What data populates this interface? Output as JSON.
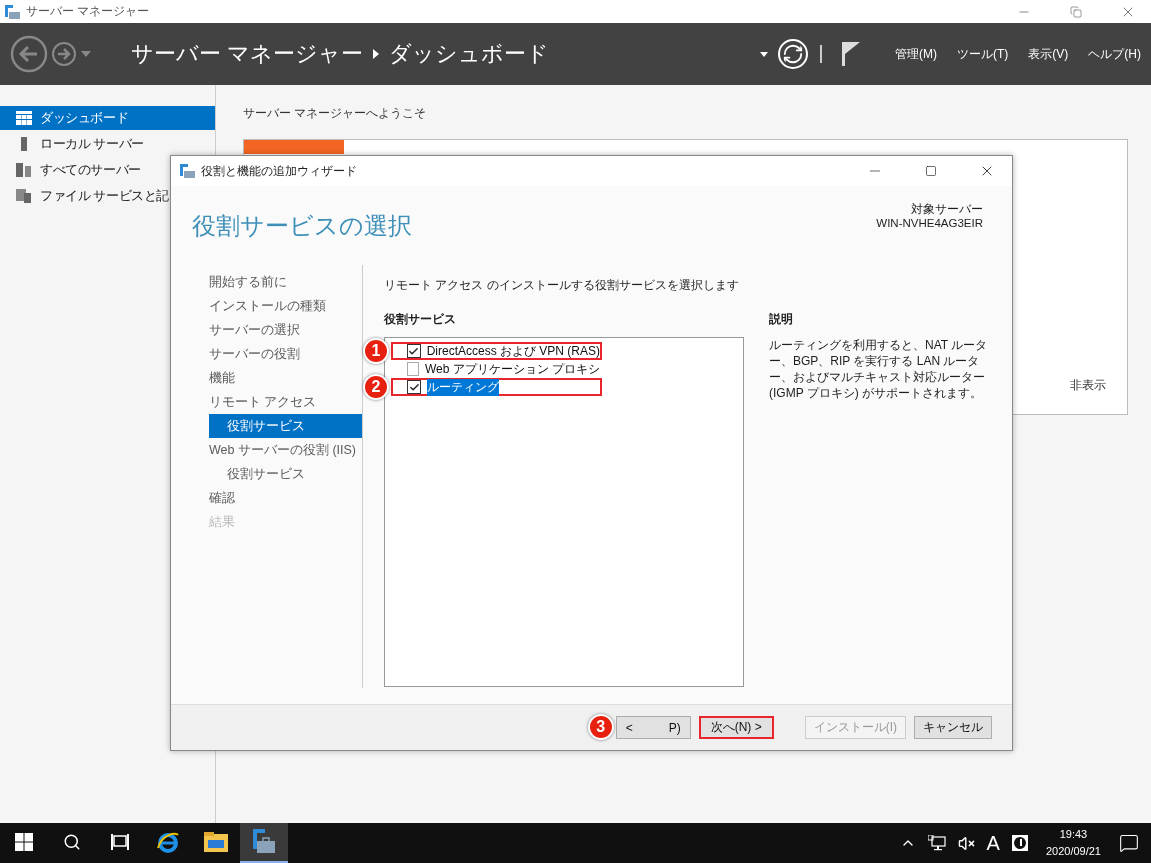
{
  "app": {
    "title": "サーバー マネージャー"
  },
  "header": {
    "breadcrumb": [
      "サーバー マネージャー",
      "ダッシュボード"
    ],
    "menus": [
      "管理(M)",
      "ツール(T)",
      "表示(V)",
      "ヘルプ(H)"
    ]
  },
  "sidebar": {
    "items": [
      {
        "kind": "dashboard",
        "label": "ダッシュボード",
        "selected": true
      },
      {
        "kind": "local",
        "label": "ローカル サーバー",
        "selected": false
      },
      {
        "kind": "all",
        "label": "すべてのサーバー",
        "selected": false
      },
      {
        "kind": "files",
        "label": "ファイル サービスと記",
        "selected": false
      }
    ]
  },
  "welcome": {
    "title": "サーバー マネージャーへようこそ",
    "hide_link": "非表示"
  },
  "wizard": {
    "title": "役割と機能の追加ウィザード",
    "page_title": "役割サービスの選択",
    "target_label": "対象サーバー",
    "target_server": "WIN-NVHE4AG3EIR",
    "steps": [
      {
        "label": "開始する前に",
        "selected": false,
        "disabled": false
      },
      {
        "label": "インストールの種類",
        "selected": false,
        "disabled": false
      },
      {
        "label": "サーバーの選択",
        "selected": false,
        "disabled": false
      },
      {
        "label": "サーバーの役割",
        "selected": false,
        "disabled": false
      },
      {
        "label": "機能",
        "selected": false,
        "disabled": false
      },
      {
        "label": "リモート アクセス",
        "selected": false,
        "disabled": false,
        "children": [
          {
            "label": "役割サービス",
            "selected": true,
            "disabled": false
          }
        ]
      },
      {
        "label": "Web サーバーの役割 (IIS)",
        "selected": false,
        "disabled": false,
        "children": [
          {
            "label": "役割サービス",
            "selected": false,
            "disabled": false
          }
        ]
      },
      {
        "label": "確認",
        "selected": false,
        "disabled": false
      },
      {
        "label": "結果",
        "selected": false,
        "disabled": true
      }
    ],
    "instruction": "リモート アクセス のインストールする役割サービスを選択します",
    "services_heading": "役割サービス",
    "services": [
      {
        "label": "DirectAccess および VPN (RAS)",
        "checked": true,
        "selected": false,
        "callout": "1"
      },
      {
        "label": "Web アプリケーション プロキシ",
        "checked": false,
        "selected": false
      },
      {
        "label": "ルーティング",
        "checked": true,
        "selected": true,
        "callout": "2"
      }
    ],
    "description": {
      "heading": "説明",
      "text": "ルーティングを利用すると、NAT ルーター、BGP、RIP を実行する LAN ルーター、およびマルチキャスト対応ルーター (IGMP プロキシ) がサポートされます。"
    },
    "buttons": [
      {
        "kind": "back",
        "label_start": "<",
        "label_end": "P)",
        "disabled": false,
        "callout": "3",
        "highlighted": false
      },
      {
        "kind": "next",
        "label": "次へ(N) >",
        "disabled": false,
        "highlighted": true
      },
      {
        "kind": "install",
        "label": "インストール(I)",
        "disabled": true,
        "highlighted": false
      },
      {
        "kind": "cancel",
        "label": "キャンセル",
        "disabled": false,
        "highlighted": false
      }
    ]
  },
  "taskbar": {
    "apps": [
      {
        "kind": "ie",
        "active": false
      },
      {
        "kind": "explorer",
        "active": false
      },
      {
        "kind": "servermanager",
        "active": true
      }
    ],
    "time": "19:43",
    "date": "2020/09/21",
    "ime": "A"
  }
}
